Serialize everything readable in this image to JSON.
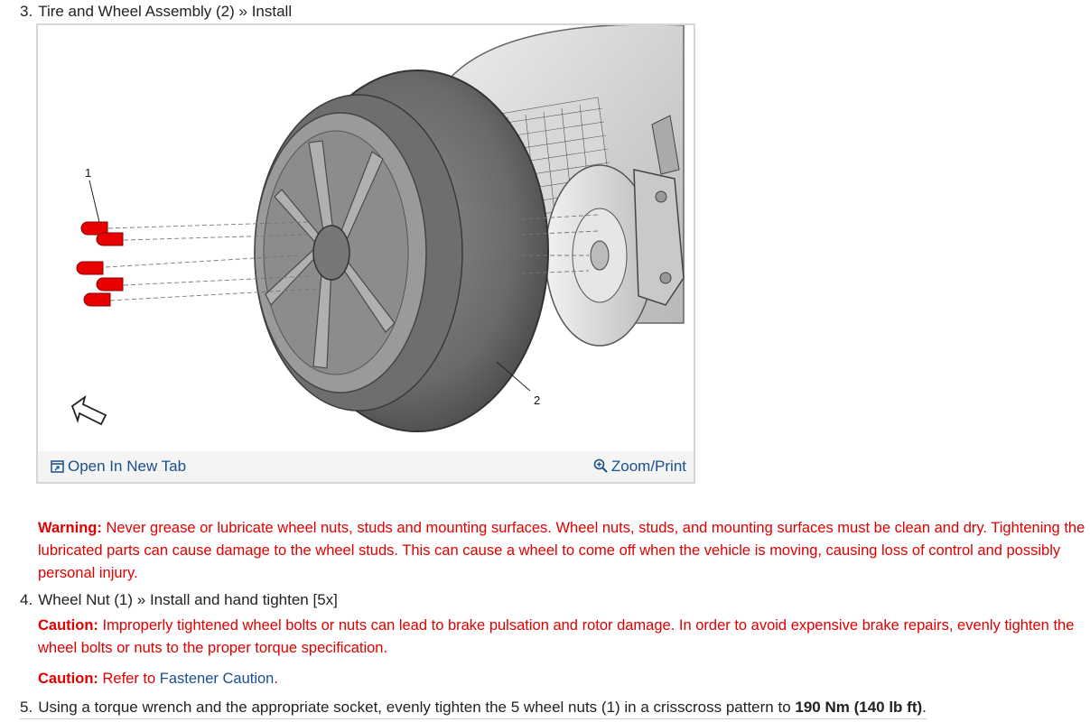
{
  "step3": {
    "num": "3.",
    "text": "Tire and Wheel Assembly (2) » Install"
  },
  "figure": {
    "callout_1": "1",
    "callout_2": "2",
    "open_in_new_tab": "Open In New Tab",
    "zoom_print": "Zoom/Print",
    "colors": {
      "nut": "#e80000",
      "link": "#1a4f8c",
      "toolbar_bg": "#f4f4f4"
    },
    "icons": [
      "open-new-tab-icon",
      "zoom-in-icon",
      "front-arrow-icon"
    ]
  },
  "warning": {
    "label": "Warning:",
    "text": " Never grease or lubricate wheel nuts, studs and mounting surfaces. Wheel nuts, studs, and mounting surfaces must be clean and dry. Tightening the lubricated parts can cause damage to the wheel studs. This can cause a wheel to come off when the vehicle is moving, causing loss of control and possibly personal injury."
  },
  "step4": {
    "num": "4.",
    "text": "Wheel Nut (1) » Install and hand tighten [5x]"
  },
  "caution1": {
    "label": "Caution:",
    "text": " Improperly tightened wheel bolts or nuts can lead to brake pulsation and rotor damage. In order to avoid expensive brake repairs, evenly tighten the wheel bolts or nuts to the proper torque specification."
  },
  "caution2": {
    "label": "Caution:",
    "pre": " Refer to ",
    "link": "Fastener Caution",
    "post": "."
  },
  "step5": {
    "num": "5.",
    "text": "Using a torque wrench and the appropriate socket, evenly tighten the 5 wheel nuts (1) in a crisscross pattern to ",
    "torque": "190 Nm  (140 lb ft)",
    "end": "."
  },
  "colors": {
    "warning_red": "#e00000",
    "text": "#222222"
  }
}
